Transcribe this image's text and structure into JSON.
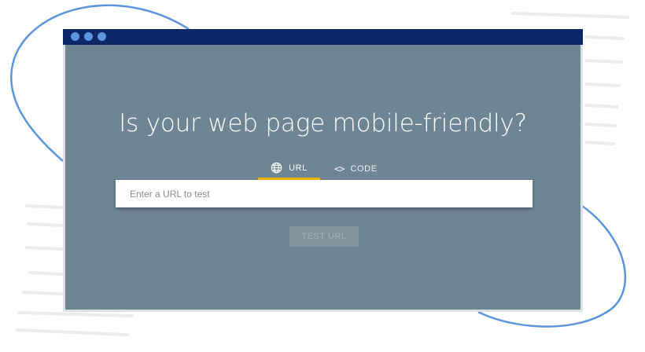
{
  "page": {
    "headline": "Is your web page mobile-friendly?"
  },
  "tabs": [
    {
      "label": "URL",
      "icon": "globe-icon",
      "selected": true
    },
    {
      "label": "CODE",
      "icon": "code-brackets-icon",
      "selected": false
    }
  ],
  "code_icon_glyph": "<>",
  "url_input": {
    "placeholder": "Enter a URL to test",
    "value": ""
  },
  "test_button": {
    "label": "TEST URL",
    "disabled": true
  },
  "colors": {
    "window_background": "#6e8594",
    "title_bar": "#0d2766",
    "window_dots": "#5b95dd",
    "tab_indicator": "#f6b400",
    "decorative_curve": "#5b95dd",
    "decorative_lines": "#ececec"
  }
}
